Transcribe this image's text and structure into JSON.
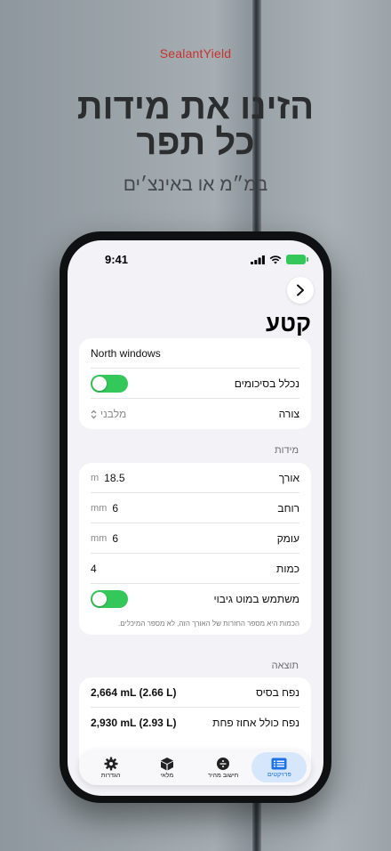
{
  "brand": "SealantYield",
  "headline": {
    "line1": "הזינו את מידות",
    "line2": "כל תפר"
  },
  "subhead": "במ״מ או באינצ׳ים",
  "status_bar": {
    "time": "9:41"
  },
  "page_title": "קטע",
  "segment": {
    "name_value": "North windows",
    "include_label": "נכלל בסיכומים",
    "include_on": true,
    "shape_label": "צורה",
    "shape_value": "מלבני"
  },
  "dimensions": {
    "header": "מידות",
    "rows": [
      {
        "label": "אורך",
        "value": "18.5",
        "unit": "m"
      },
      {
        "label": "רוחב",
        "value": "6",
        "unit": "mm"
      },
      {
        "label": "עומק",
        "value": "6",
        "unit": "mm"
      },
      {
        "label": "כמות",
        "value": "4",
        "unit": ""
      }
    ],
    "backer_label": "משתמש במוט גיבוי",
    "backer_on": true,
    "footnote": "הכמות היא מספר החזרות של האורך הזה, לא מספר המיכלים."
  },
  "result": {
    "header": "תוצאה",
    "rows": [
      {
        "label": "נפח בסיס",
        "value": "2,664 mL (2.66 L)"
      },
      {
        "label": "נפח כולל אחוז פחת",
        "value": "2,930 mL (2.93 L)"
      }
    ]
  },
  "tabs": [
    {
      "label": "פרויקטים",
      "icon": "projects-icon",
      "active": true
    },
    {
      "label": "חישוב מהיר",
      "icon": "quick-calc-icon",
      "active": false
    },
    {
      "label": "מלאי",
      "icon": "inventory-box-icon",
      "active": false
    },
    {
      "label": "הגדרות",
      "icon": "gear-icon",
      "active": false
    }
  ],
  "colors": {
    "accent": "#1b72e8",
    "toggle_on": "#34c759",
    "brand": "#c8322f"
  }
}
